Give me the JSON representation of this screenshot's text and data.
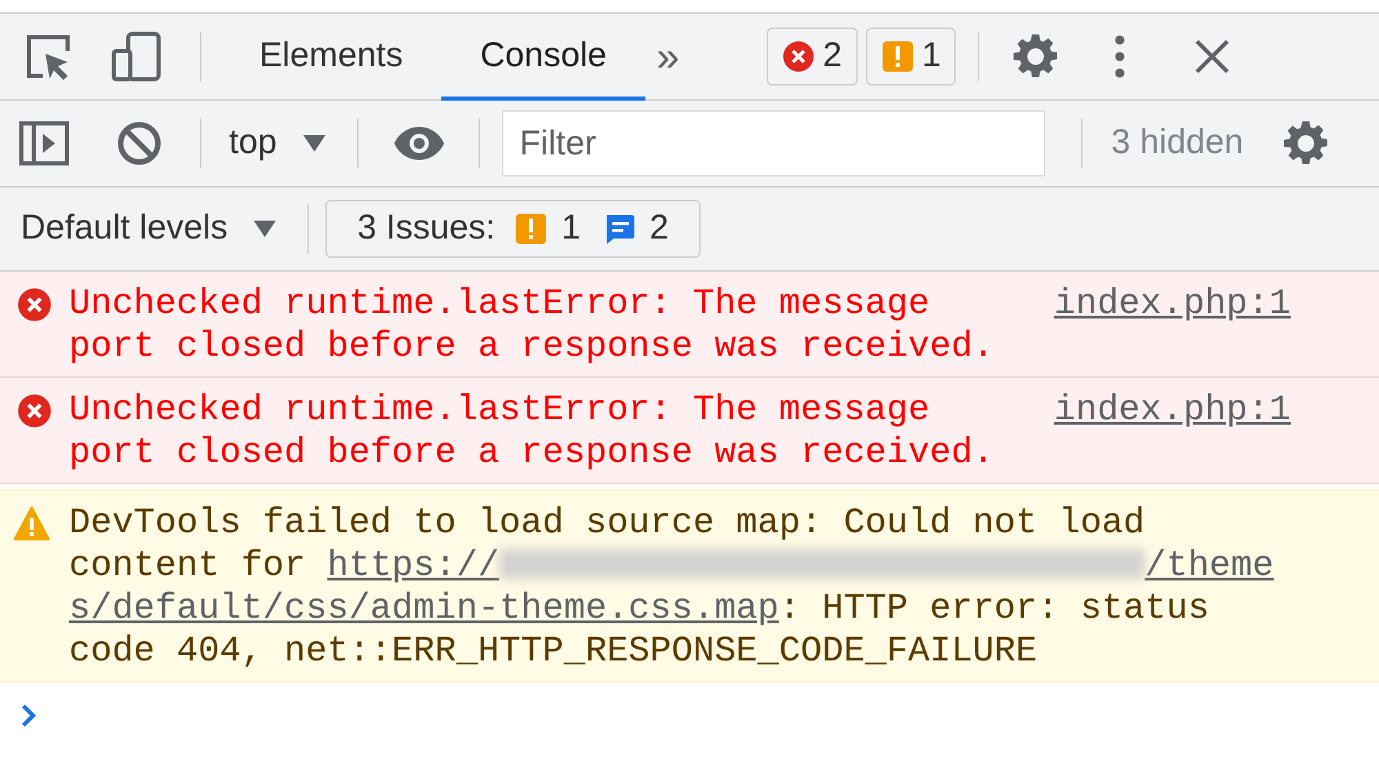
{
  "toolbar": {
    "tabs": [
      {
        "label": "Elements",
        "selected": false
      },
      {
        "label": "Console",
        "selected": true
      }
    ],
    "more_tabs": "»",
    "error_count": "2",
    "warning_count": "1"
  },
  "console_toolbar": {
    "context": "top",
    "filter": {
      "placeholder": "Filter"
    },
    "hidden_count": "3 hidden",
    "levels": "Default levels",
    "issues": {
      "label": "3 Issues:",
      "warning_count": "1",
      "info_count": "2"
    }
  },
  "messages": [
    {
      "kind": "error",
      "text": "Unchecked runtime.lastError: The message port closed before a response was received.",
      "source": "index.php:1"
    },
    {
      "kind": "error",
      "text": "Unchecked runtime.lastError: The message port closed before a response was received.",
      "source": "index.php:1"
    },
    {
      "kind": "warning",
      "text_before": "DevTools failed to load source map: Could not load content for ",
      "url_start": "https://",
      "url_end": "/theme",
      "url_continued": "s/default/css/admin-theme.css.map",
      "text_after": ": HTTP error: status code 404, net::ERR_HTTP_RESPONSE_CODE_FAILURE"
    }
  ]
}
